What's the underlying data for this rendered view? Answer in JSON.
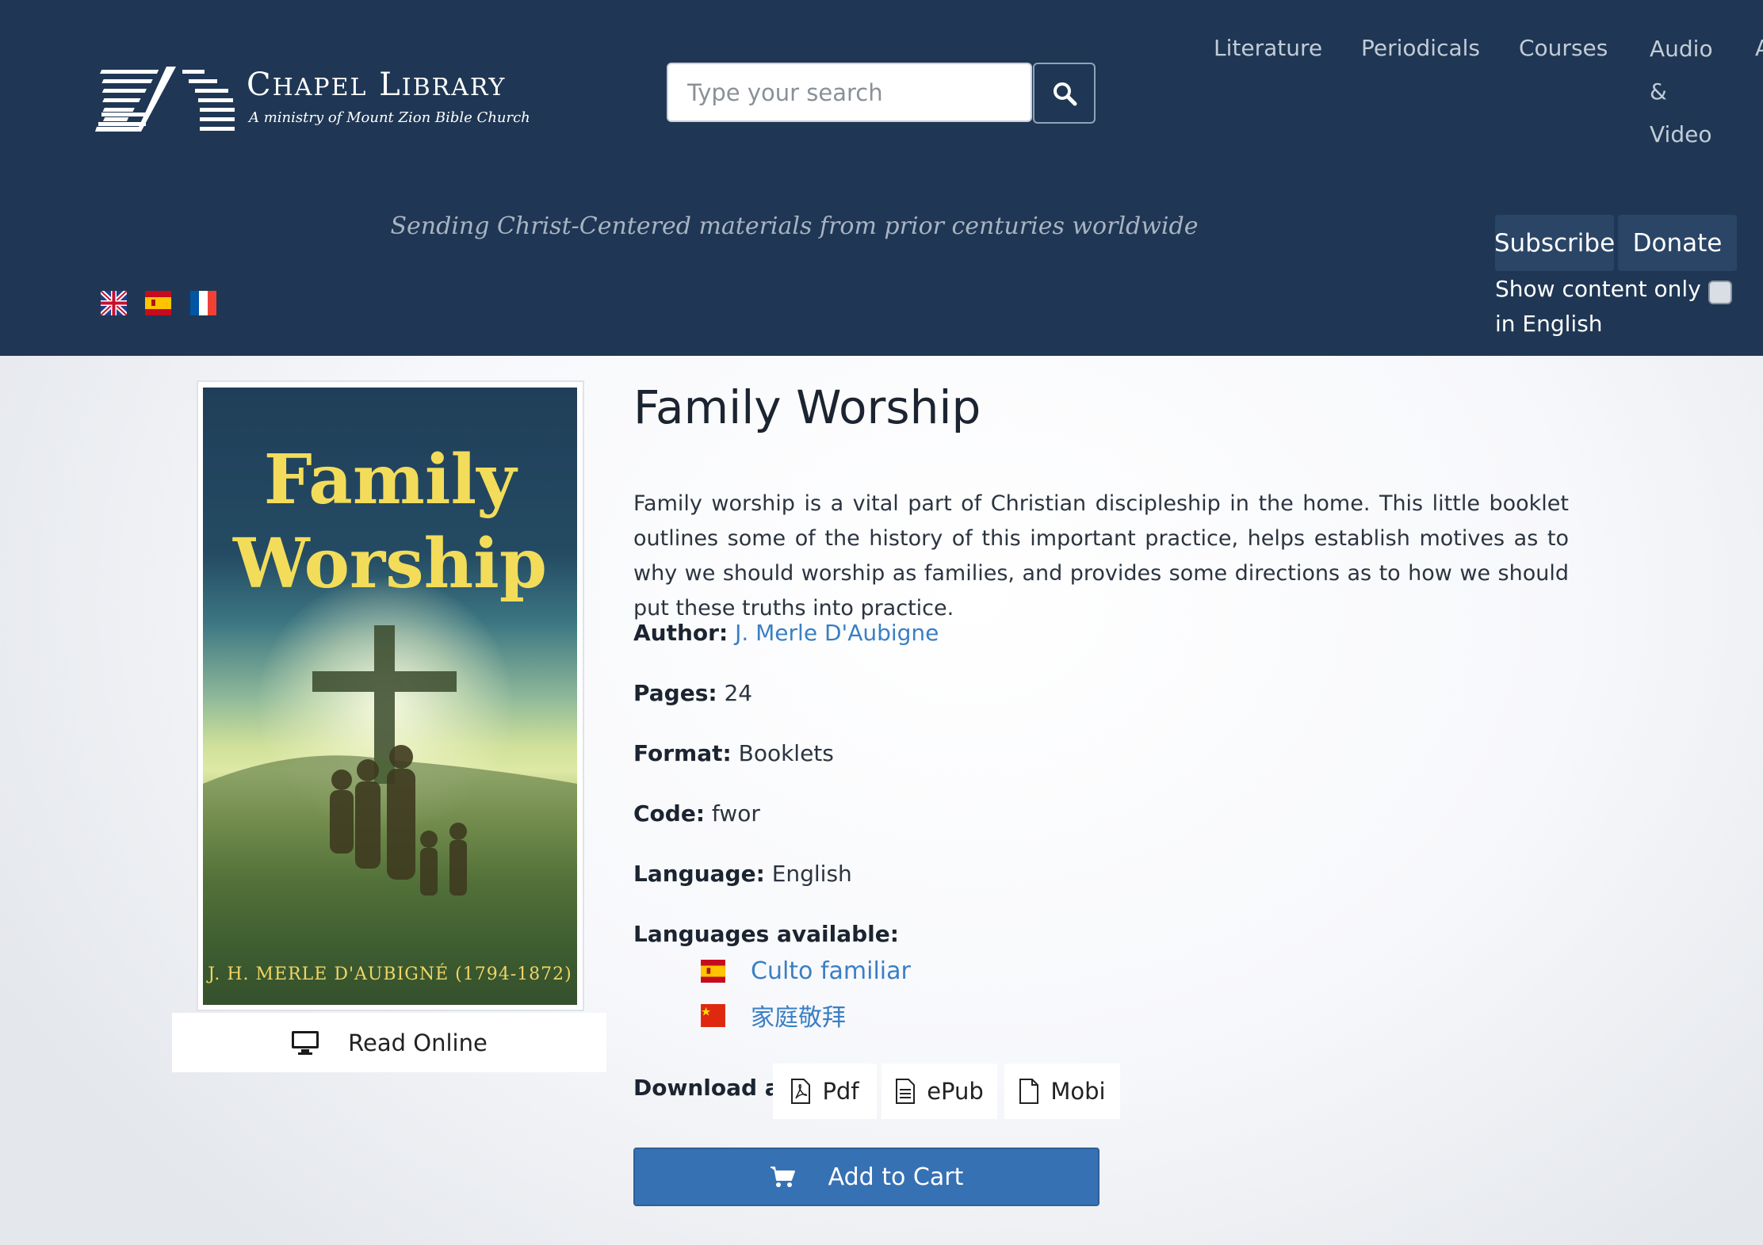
{
  "header": {
    "logo": {
      "name_first": "C",
      "name_first_rest": "HAPEL",
      "name_second": "L",
      "name_second_rest": "IBRARY",
      "tagline": "A ministry of Mount Zion Bible Church"
    },
    "search": {
      "placeholder": "Type your search"
    },
    "nav": [
      {
        "label": "Literature"
      },
      {
        "label": "Periodicals"
      },
      {
        "label": "Courses"
      },
      {
        "label_lines": [
          "Audio",
          "&",
          "Video"
        ]
      },
      {
        "label": "A"
      }
    ],
    "tagline": "Sending Christ-Centered materials from prior centuries worldwide",
    "subscribe_label": "Subscribe",
    "donate_label": "Donate",
    "show_english_label": "Show content only in English",
    "language_flags": [
      "uk-flag",
      "spain-flag",
      "france-flag"
    ]
  },
  "book": {
    "cover": {
      "title_line1": "Family",
      "title_line2": "Worship",
      "author": "J. H. MERLE D'AUBIGNÉ (1794-1872)"
    },
    "read_online_label": "Read Online",
    "title": "Family Worship",
    "description": "Family worship is a vital part of Christian discipleship in the home. This little booklet outlines some of the history of this important practice, helps establish motives as to why we should worship as families, and provides some directions as to how we should put these truths into practice.",
    "author_label": "Author:",
    "author": "J. Merle D'Aubigne",
    "pages_label": "Pages:",
    "pages": "24",
    "format_label": "Format:",
    "format": "Booklets",
    "code_label": "Code:",
    "code": "fwor",
    "language_label": "Language:",
    "language": "English",
    "languages_available_label": "Languages available:",
    "languages_available": [
      {
        "flag": "spain-flag",
        "title": "Culto familiar"
      },
      {
        "flag": "china-flag",
        "title": "家庭敬拜"
      }
    ],
    "download_label": "Download as:",
    "downloads": [
      {
        "icon": "pdf-file-icon",
        "label": "Pdf"
      },
      {
        "icon": "text-file-icon",
        "label": "ePub"
      },
      {
        "icon": "file-icon",
        "label": "Mobi"
      }
    ],
    "add_to_cart_label": "Add to Cart"
  },
  "colors": {
    "header_bg": "#1f3754",
    "link": "#3a7fc4",
    "cart_button": "#3671b4",
    "cover_title": "#f3dc5a"
  }
}
